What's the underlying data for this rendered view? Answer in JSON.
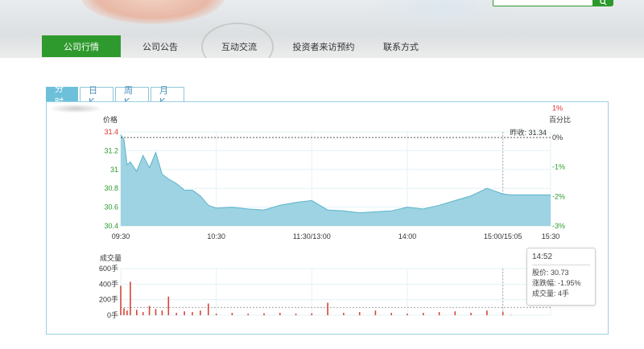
{
  "search": {
    "placeholder": "",
    "button_icon": "search-icon"
  },
  "nav": {
    "items": [
      {
        "label": "公司行情",
        "active": true
      },
      {
        "label": "公司公告",
        "active": false
      },
      {
        "label": "互动交流",
        "active": false
      },
      {
        "label": "投资者来访预约",
        "active": false
      },
      {
        "label": "联系方式",
        "active": false
      }
    ]
  },
  "tabs": [
    {
      "label": "分时",
      "active": true
    },
    {
      "label": "日 K",
      "active": false
    },
    {
      "label": "周 K",
      "active": false
    },
    {
      "label": "月 K",
      "active": false
    }
  ],
  "colors": {
    "accent": "#2e9a2e",
    "area_fill": "#9dd3e2",
    "area_line": "#5bb3cc",
    "bar": "#d6453a",
    "up": "#e0302b",
    "down": "#2b9a2b"
  },
  "chart_data": [
    {
      "type": "area",
      "title": "",
      "ylabel_left": "价格",
      "ylabel_right": "百分比",
      "prev_close_label": "昨收: 31.34",
      "prev_close": 31.34,
      "ylim": [
        30.4,
        31.4
      ],
      "y_ticks": [
        "31.4",
        "31.2",
        "31",
        "30.8",
        "30.6",
        "30.4"
      ],
      "pct_ticks": [
        "1%",
        "0%",
        "-1%",
        "-2%",
        "-3%"
      ],
      "x_ticks": [
        "09:30",
        "10:30",
        "11:30/13:00",
        "14:00",
        "15:00/15:05",
        "15:30"
      ],
      "x": [
        "09:30",
        "09:32",
        "09:34",
        "09:36",
        "09:40",
        "09:44",
        "09:48",
        "09:52",
        "09:56",
        "10:00",
        "10:05",
        "10:10",
        "10:15",
        "10:20",
        "10:25",
        "10:30",
        "10:40",
        "10:50",
        "11:00",
        "11:10",
        "11:20",
        "11:30",
        "13:10",
        "13:20",
        "13:30",
        "13:40",
        "13:50",
        "14:00",
        "14:10",
        "14:20",
        "14:30",
        "14:40",
        "14:50",
        "15:00",
        "15:05",
        "15:30"
      ],
      "values": [
        31.37,
        31.32,
        31.05,
        31.08,
        30.98,
        31.15,
        31.02,
        31.18,
        30.95,
        30.9,
        30.85,
        30.78,
        30.78,
        30.72,
        30.62,
        30.59,
        30.6,
        30.58,
        30.57,
        30.62,
        30.65,
        30.67,
        30.57,
        30.56,
        30.54,
        30.55,
        30.56,
        30.6,
        30.58,
        30.62,
        30.67,
        30.72,
        30.8,
        30.74,
        30.73,
        30.73
      ]
    },
    {
      "type": "bar",
      "title": "",
      "ylabel": "成交量",
      "y_ticks": [
        "600手",
        "400手",
        "200手",
        "0手"
      ],
      "ylim": [
        0,
        600
      ],
      "x": [
        "09:30",
        "09:32",
        "09:34",
        "09:36",
        "09:40",
        "09:44",
        "09:48",
        "09:52",
        "09:56",
        "10:00",
        "10:05",
        "10:10",
        "10:15",
        "10:20",
        "10:25",
        "10:30",
        "10:40",
        "10:50",
        "11:00",
        "11:10",
        "11:20",
        "11:30",
        "13:10",
        "13:20",
        "13:30",
        "13:40",
        "13:50",
        "14:00",
        "14:10",
        "14:20",
        "14:30",
        "14:40",
        "14:50",
        "15:00",
        "15:05",
        "15:30"
      ],
      "values": [
        380,
        90,
        60,
        430,
        70,
        40,
        120,
        80,
        60,
        240,
        30,
        50,
        40,
        60,
        150,
        20,
        30,
        20,
        25,
        30,
        20,
        25,
        160,
        30,
        40,
        60,
        30,
        20,
        30,
        40,
        50,
        30,
        60,
        40,
        4,
        0
      ]
    }
  ],
  "tooltip": {
    "time": "14:52",
    "price": "股价: 30.73",
    "change": "涨跌幅: -1.95%",
    "volume": "成交量: 4手"
  }
}
